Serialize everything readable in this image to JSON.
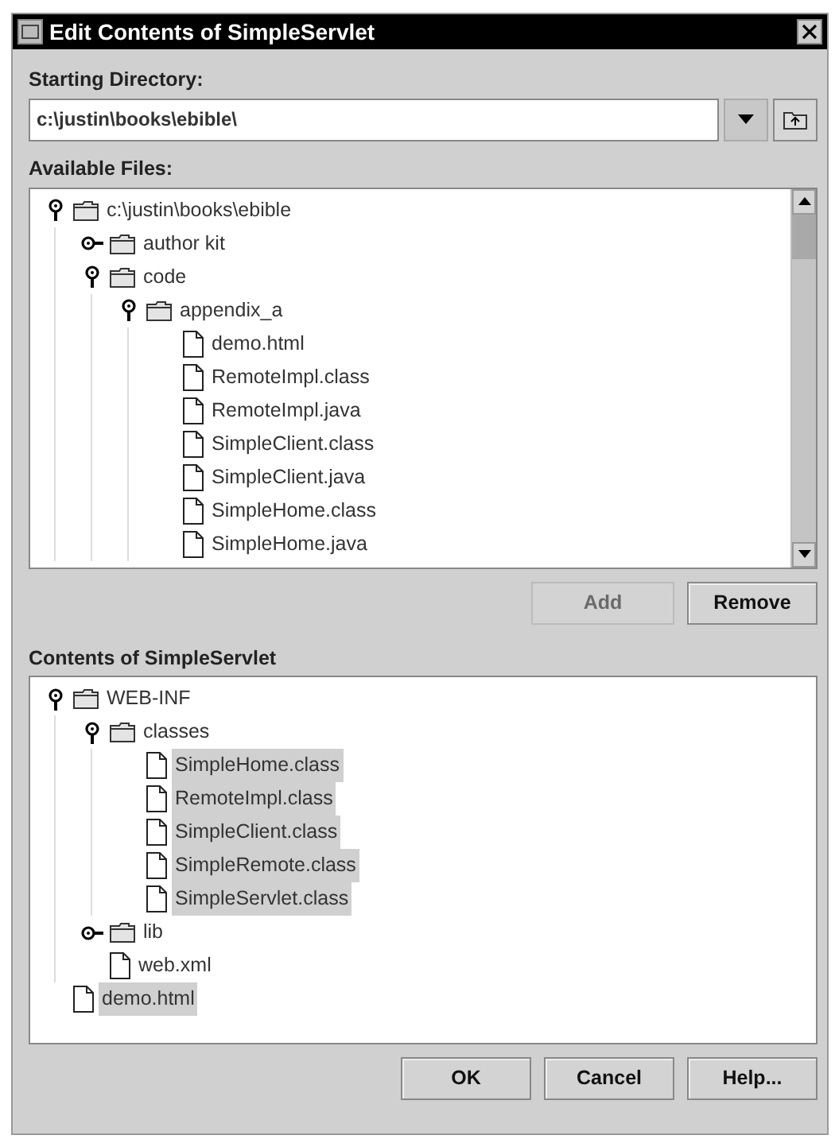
{
  "window": {
    "title": "Edit Contents of SimpleServlet"
  },
  "starting_directory": {
    "label": "Starting Directory:",
    "value": "c:\\justin\\books\\ebible\\"
  },
  "available_files": {
    "label": "Available Files:",
    "tree": [
      {
        "kind": "folder",
        "label": "c:\\justin\\books\\ebible",
        "expanded": true,
        "selected": false,
        "children": [
          {
            "kind": "folder",
            "label": "author kit",
            "expanded": false,
            "selected": false
          },
          {
            "kind": "folder",
            "label": "code",
            "expanded": true,
            "selected": false,
            "children": [
              {
                "kind": "folder",
                "label": "appendix_a",
                "expanded": true,
                "selected": false,
                "children": [
                  {
                    "kind": "file",
                    "label": "demo.html",
                    "selected": false
                  },
                  {
                    "kind": "file",
                    "label": "RemoteImpl.class",
                    "selected": false
                  },
                  {
                    "kind": "file",
                    "label": "RemoteImpl.java",
                    "selected": false
                  },
                  {
                    "kind": "file",
                    "label": "SimpleClient.class",
                    "selected": false
                  },
                  {
                    "kind": "file",
                    "label": "SimpleClient.java",
                    "selected": false
                  },
                  {
                    "kind": "file",
                    "label": "SimpleHome.class",
                    "selected": false
                  },
                  {
                    "kind": "file",
                    "label": "SimpleHome.java",
                    "selected": false
                  }
                ]
              }
            ]
          }
        ]
      }
    ]
  },
  "middle_buttons": [
    {
      "label": "Add",
      "disabled": true
    },
    {
      "label": "Remove",
      "disabled": false
    }
  ],
  "contents": {
    "label": "Contents of SimpleServlet",
    "tree": [
      {
        "kind": "folder",
        "label": "WEB-INF",
        "expanded": true,
        "selected": false,
        "children": [
          {
            "kind": "folder",
            "label": "classes",
            "expanded": true,
            "selected": false,
            "children": [
              {
                "kind": "file",
                "label": "SimpleHome.class",
                "selected": true
              },
              {
                "kind": "file",
                "label": "RemoteImpl.class",
                "selected": true
              },
              {
                "kind": "file",
                "label": "SimpleClient.class",
                "selected": true
              },
              {
                "kind": "file",
                "label": "SimpleRemote.class",
                "selected": true
              },
              {
                "kind": "file",
                "label": "SimpleServlet.class",
                "selected": true
              }
            ]
          },
          {
            "kind": "folder",
            "label": "lib",
            "expanded": false,
            "selected": false
          },
          {
            "kind": "file",
            "label": "web.xml",
            "selected": false
          }
        ]
      },
      {
        "kind": "file",
        "label": "demo.html",
        "selected": true
      }
    ]
  },
  "buttons": [
    {
      "label": "OK",
      "disabled": false
    },
    {
      "label": "Cancel",
      "disabled": false
    },
    {
      "label": "Help...",
      "disabled": false
    }
  ]
}
